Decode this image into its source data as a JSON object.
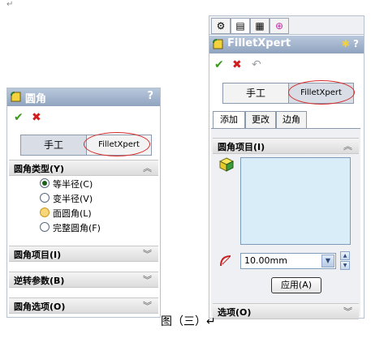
{
  "top_para_mark": "↵",
  "left_panel": {
    "title": "圆角",
    "help": "?",
    "tabs": {
      "manual": "手工",
      "fillet_xpert": "FilletXpert"
    },
    "sections": {
      "fillet_type": "圆角类型(Y)",
      "fillet_items": "圆角项目(I)",
      "setback_params": "逆转参数(B)",
      "fillet_options": "圆角选项(O)"
    },
    "radio_options": [
      "等半径(C)",
      "变半径(V)",
      "面圆角(L)",
      "完整圆角(F)"
    ],
    "selected_option": 0
  },
  "right_panel": {
    "title": "FilletXpert",
    "help": "?",
    "tabs": {
      "manual": "手工",
      "fillet_xpert": "FilletXpert"
    },
    "sub_tabs": [
      "添加",
      "更改",
      "边角"
    ],
    "sections": {
      "fillet_items": "圆角项目(I)",
      "options": "选项(O)"
    },
    "radius_value": "10.00mm",
    "apply_label": "应用(A)"
  },
  "caption": "图（三）↵",
  "colors": {
    "title_bar": "#8fa3bf",
    "selection_box": "#d8edf8",
    "annotation_ellipse": "#d62b2b",
    "ok_check": "#3a9a1c",
    "cancel_x": "#d11d1d"
  }
}
